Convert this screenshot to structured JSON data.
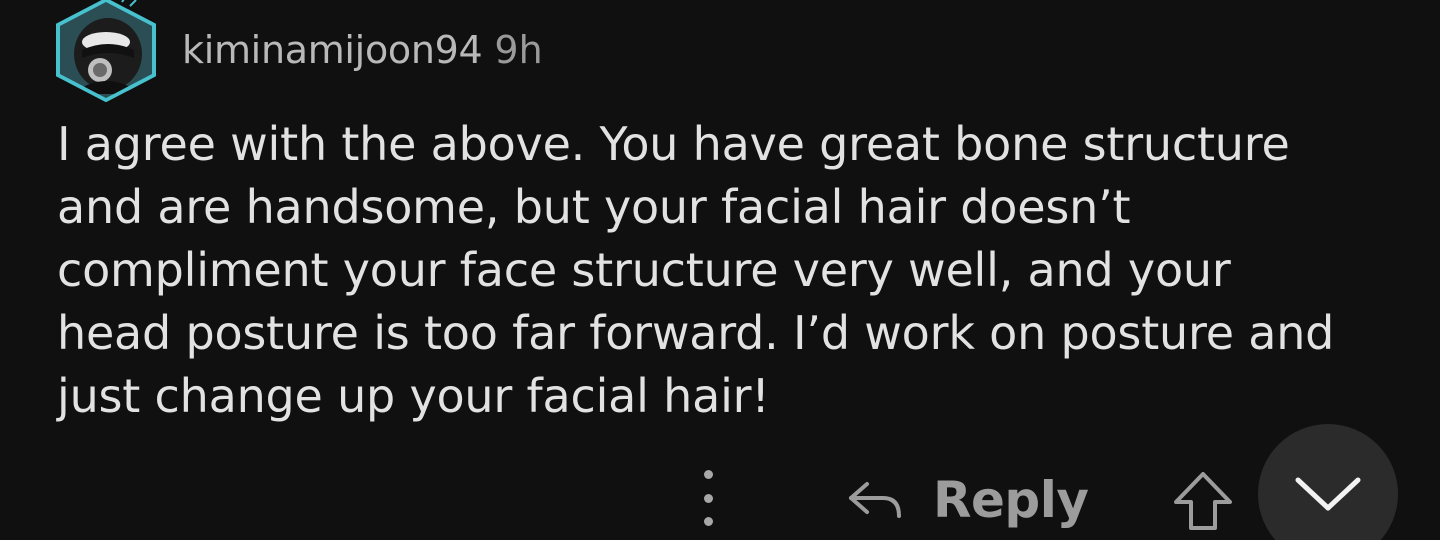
{
  "comment": {
    "author": "kiminamijoon94",
    "time": "9h",
    "avatar_icon": "hooded-snoo-avatar-icon",
    "body": "I agree with the above. You have great bone structure\nand are handsome, but your facial hair doesn’t\ncompliment your face structure very well, and your\nhead posture is too far forward. I’d work on posture and\njust change up your facial hair!"
  },
  "actions": {
    "more_icon": "vertical-ellipsis-icon",
    "reply_icon": "reply-arrow-icon",
    "reply_label": "Reply",
    "upvote_icon": "upvote-arrow-icon",
    "downvote_icon": "chevron-down-icon"
  },
  "colors": {
    "background": "#101010",
    "text": "#e2e2e2",
    "muted": "#9c9c9c",
    "avatar_accent": "#3fb6c4"
  }
}
